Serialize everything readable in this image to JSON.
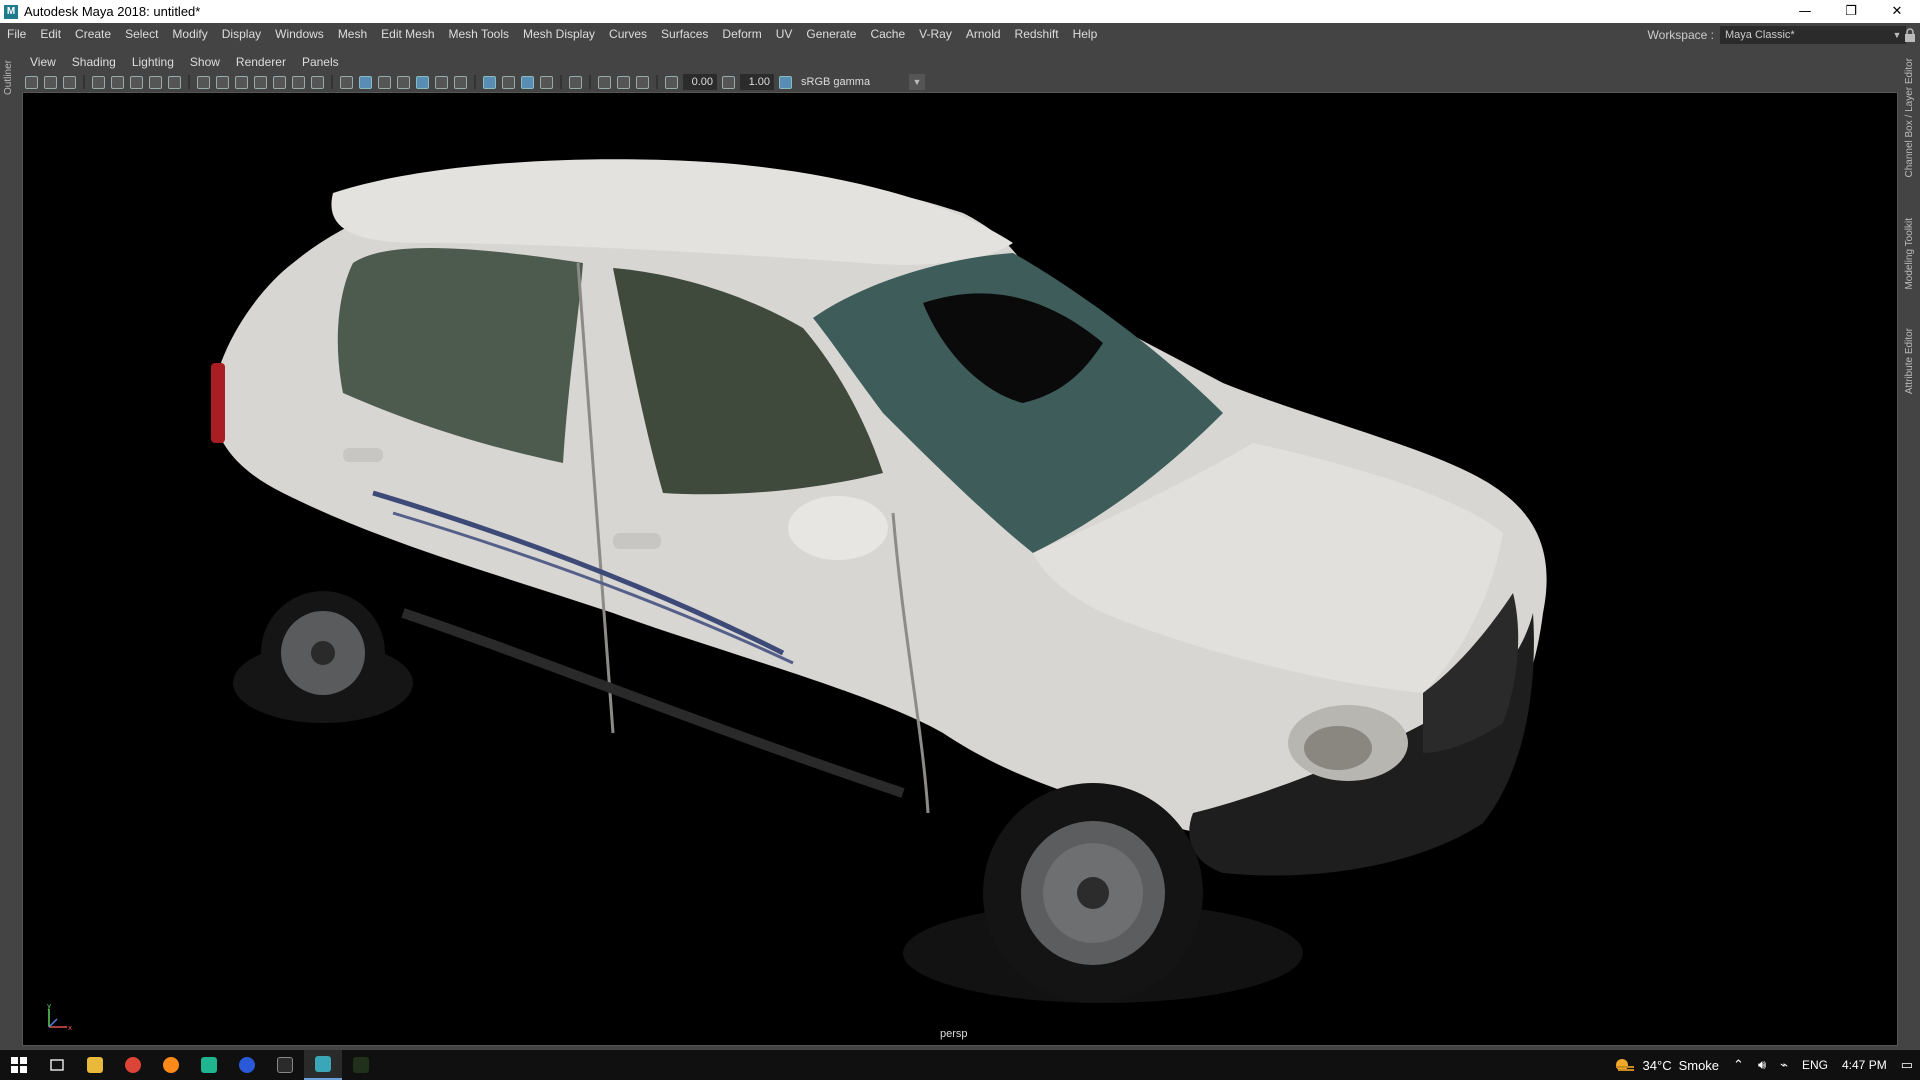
{
  "window": {
    "title": "Autodesk Maya 2018: untitled*",
    "minimize": "—",
    "restore": "❐",
    "close": "✕"
  },
  "menubar": {
    "items": [
      "File",
      "Edit",
      "Create",
      "Select",
      "Modify",
      "Display",
      "Windows",
      "Mesh",
      "Edit Mesh",
      "Mesh Tools",
      "Mesh Display",
      "Curves",
      "Surfaces",
      "Deform",
      "UV",
      "Generate",
      "Cache",
      "V-Ray",
      "Arnold",
      "Redshift",
      "Help"
    ]
  },
  "workspace": {
    "label": "Workspace :",
    "value": "Maya Classic*"
  },
  "left_strip": {
    "outliner": "Outliner"
  },
  "right_strip": {
    "channel_box": "Channel Box / Layer Editor",
    "modeling_toolkit": "Modeling Toolkit",
    "attribute_editor": "Attribute Editor"
  },
  "panel_menu": {
    "items": [
      "View",
      "Shading",
      "Lighting",
      "Show",
      "Renderer",
      "Panels"
    ]
  },
  "toolbar": {
    "exposure": "0.00",
    "gamma": "1.00",
    "color_space": "sRGB gamma"
  },
  "viewport": {
    "camera": "persp",
    "axis_y": "y",
    "axis_x": "x"
  },
  "taskbar": {
    "weather_temp": "34°C",
    "weather_desc": "Smoke",
    "language": "ENG",
    "time": "4:47 PM"
  },
  "colors": {
    "maya_bg": "#444444",
    "viewport_bg": "#000000",
    "car_body": "#dcdad6",
    "taskbar": "#101010"
  }
}
